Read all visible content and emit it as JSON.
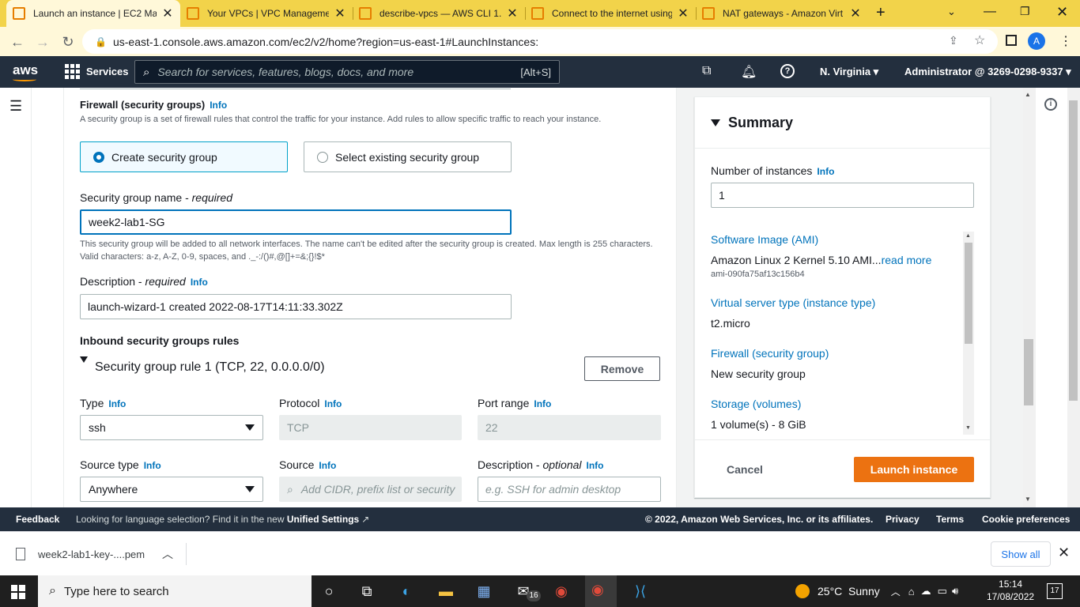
{
  "browser": {
    "tabs": [
      {
        "title": "Launch an instance | EC2 Ma",
        "active": true
      },
      {
        "title": "Your VPCs | VPC Managemer",
        "active": false
      },
      {
        "title": "describe-vpcs — AWS CLI 1.2",
        "active": false
      },
      {
        "title": "Connect to the internet using",
        "active": false
      },
      {
        "title": "NAT gateways - Amazon Virt",
        "active": false
      }
    ],
    "url": "us-east-1.console.aws.amazon.com/ec2/v2/home?region=us-east-1#LaunchInstances:",
    "profile_initial": "A"
  },
  "aws_header": {
    "logo": "aws",
    "services_label": "Services",
    "search_placeholder": "Search for services, features, blogs, docs, and more",
    "search_shortcut": "[Alt+S]",
    "region": "N. Virginia",
    "account": "Administrator @ 3269-0298-9337"
  },
  "firewall": {
    "title": "Firewall (security groups)",
    "info": "Info",
    "description": "A security group is a set of firewall rules that control the traffic for your instance. Add rules to allow specific traffic to reach your instance.",
    "options": [
      "Create security group",
      "Select existing security group"
    ],
    "selected": "Create security group",
    "sg_name_label": "Security group name - ",
    "sg_name_required": "required",
    "sg_name_value": "week2-lab1-SG",
    "sg_name_help": "This security group will be added to all network interfaces. The name can't be edited after the security group is created. Max length is 255 characters. Valid characters: a-z, A-Z, 0-9, spaces, and ._-:/()#,@[]+=&;{}!$*",
    "desc_label": "Description - ",
    "desc_required": "required",
    "desc_value": "launch-wizard-1 created 2022-08-17T14:11:33.302Z"
  },
  "inbound": {
    "title": "Inbound security groups rules",
    "rule_title": "Security group rule 1 (TCP, 22, 0.0.0.0/0)",
    "remove_label": "Remove",
    "type_label": "Type",
    "type_value": "ssh",
    "protocol_label": "Protocol",
    "protocol_value": "TCP",
    "port_label": "Port range",
    "port_value": "22",
    "source_type_label": "Source type",
    "source_type_value": "Anywhere",
    "source_label": "Source",
    "source_placeholder": "Add CIDR, prefix list or security",
    "rule_desc_label": "Description - ",
    "rule_desc_optional": "optional",
    "rule_desc_placeholder": "e.g. SSH for admin desktop"
  },
  "summary": {
    "title": "Summary",
    "num_label": "Number of instances",
    "info": "Info",
    "num_value": "1",
    "ami_label": "Software Image (AMI)",
    "ami_value": "Amazon Linux 2 Kernel 5.10 AMI...",
    "ami_read_more": "read more",
    "ami_id": "ami-090fa75af13c156b4",
    "type_label": "Virtual server type (instance type)",
    "type_value": "t2.micro",
    "firewall_label": "Firewall (security group)",
    "firewall_value": "New security group",
    "storage_label": "Storage (volumes)",
    "storage_value": "1 volume(s) - 8 GiB",
    "cancel_label": "Cancel",
    "launch_label": "Launch instance"
  },
  "footer": {
    "feedback": "Feedback",
    "lang_text": "Looking for language selection? Find it in the new",
    "unified": "Unified Settings",
    "copyright": "© 2022, Amazon Web Services, Inc. or its affiliates.",
    "privacy": "Privacy",
    "terms": "Terms",
    "cookies": "Cookie preferences"
  },
  "downloads": {
    "file": "week2-lab1-key-....pem",
    "show_all": "Show all"
  },
  "taskbar": {
    "search_placeholder": "Type here to search",
    "weather": "25°C  Sunny",
    "time": "15:14",
    "date": "17/08/2022",
    "mail_badge": "16",
    "notif_count": "17"
  },
  "colors": {
    "aws_nav": "#232f3e",
    "primary_orange": "#ec7211",
    "link_blue": "#0073bb",
    "tabstrip_yellow": "#f2d34a"
  }
}
